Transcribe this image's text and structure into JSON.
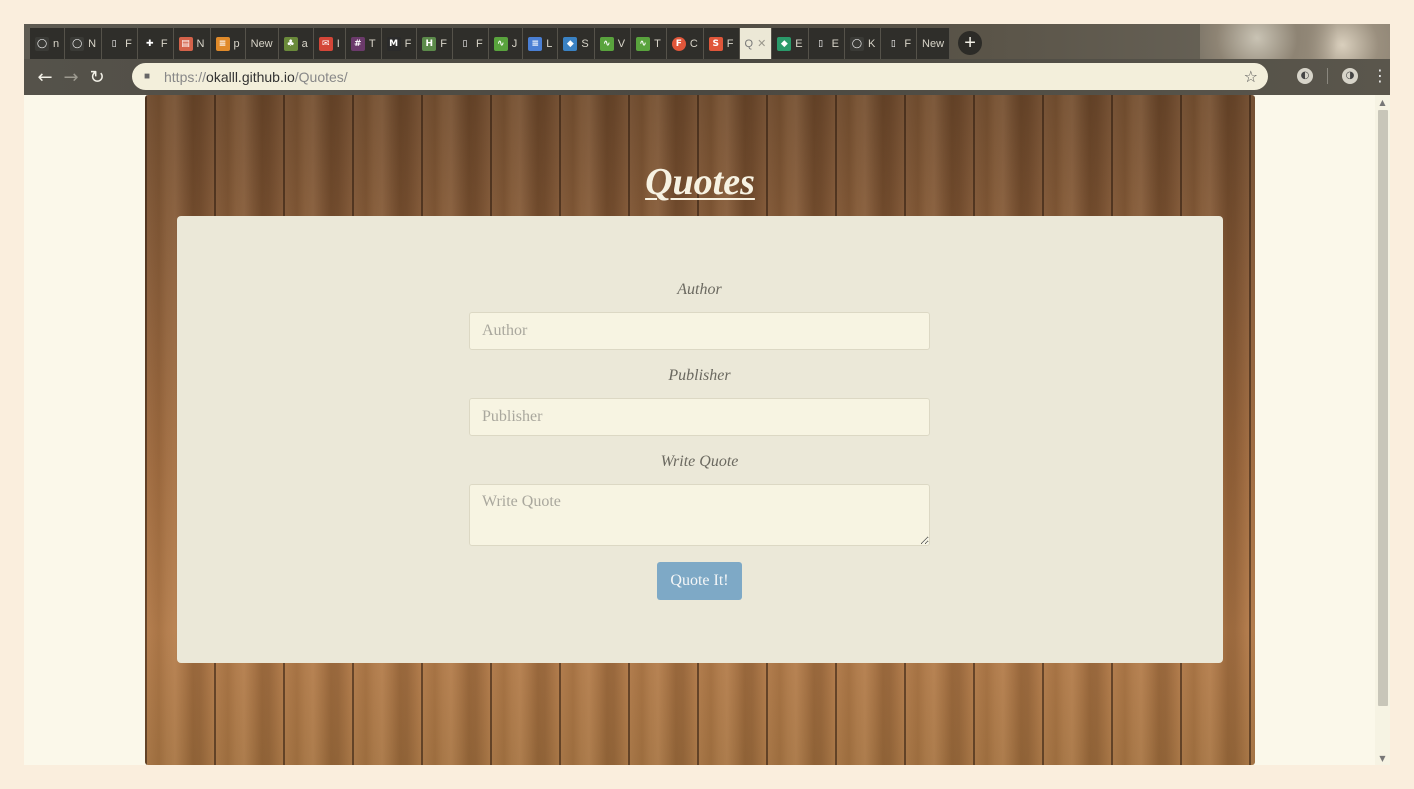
{
  "browser": {
    "tabs": [
      {
        "icon": "github-icon",
        "label": "n",
        "color": "#3a3a36"
      },
      {
        "icon": "github-icon",
        "label": "N",
        "color": "#3a3a36"
      },
      {
        "icon": "document-icon",
        "label": "F",
        "color": "#2f2e2a"
      },
      {
        "icon": "puzzle-icon",
        "label": "F",
        "color": "#2f2e2a"
      },
      {
        "icon": "scroll-icon",
        "label": "N",
        "color": "#d4624a"
      },
      {
        "icon": "stack-icon",
        "label": "p",
        "color": "#e08a2a"
      },
      {
        "icon": "",
        "label": "New",
        "color": ""
      },
      {
        "icon": "leaf-icon",
        "label": "a",
        "color": "#6a8a3a"
      },
      {
        "icon": "gmail-icon",
        "label": "I",
        "color": "#d44638"
      },
      {
        "icon": "slack-icon",
        "label": "T",
        "color": "#6b3a6b"
      },
      {
        "icon": "medium-icon",
        "label": "F",
        "color": "#2b2b2b"
      },
      {
        "icon": "hackerrank-icon",
        "label": "F",
        "color": "#5b8a4a"
      },
      {
        "icon": "document-icon",
        "label": "F",
        "color": "#2f2e2a"
      },
      {
        "icon": "chart-icon",
        "label": "J",
        "color": "#59a33d"
      },
      {
        "icon": "docs-icon",
        "label": "L",
        "color": "#4a7fd4"
      },
      {
        "icon": "bookmark-icon",
        "label": "S",
        "color": "#3a82c4"
      },
      {
        "icon": "chart-icon",
        "label": "V",
        "color": "#59a33d"
      },
      {
        "icon": "chart-icon",
        "label": "T",
        "color": "#59a33d"
      },
      {
        "icon": "f-circle-icon",
        "label": "C",
        "color": "#e0563a"
      },
      {
        "icon": "s-square-icon",
        "label": "F",
        "color": "#e0563a"
      },
      {
        "icon": "",
        "label": "Q",
        "color": "",
        "active": true
      },
      {
        "icon": "diamond-icon",
        "label": "E",
        "color": "#2a9a6a"
      },
      {
        "icon": "document-icon",
        "label": "E",
        "color": "#2f2e2a"
      },
      {
        "icon": "github-icon",
        "label": "K",
        "color": "#3a3a36"
      },
      {
        "icon": "document-icon",
        "label": "F",
        "color": "#2f2e2a"
      },
      {
        "icon": "",
        "label": "New",
        "color": ""
      }
    ],
    "newtab_symbol": "+",
    "url": {
      "scheme": "https://",
      "host": "okalll.github.io",
      "path": "/Quotes/"
    }
  },
  "page": {
    "title": "Quotes",
    "form": {
      "author": {
        "label": "Author",
        "placeholder": "Author"
      },
      "publisher": {
        "label": "Publisher",
        "placeholder": "Publisher"
      },
      "quote": {
        "label": "Write Quote",
        "placeholder": "Write Quote"
      },
      "submit_label": "Quote It!"
    }
  },
  "colors": {
    "accent_button": "#7ea9c6",
    "card_background": "#ebe8d8",
    "page_background": "#fbf8ea"
  }
}
